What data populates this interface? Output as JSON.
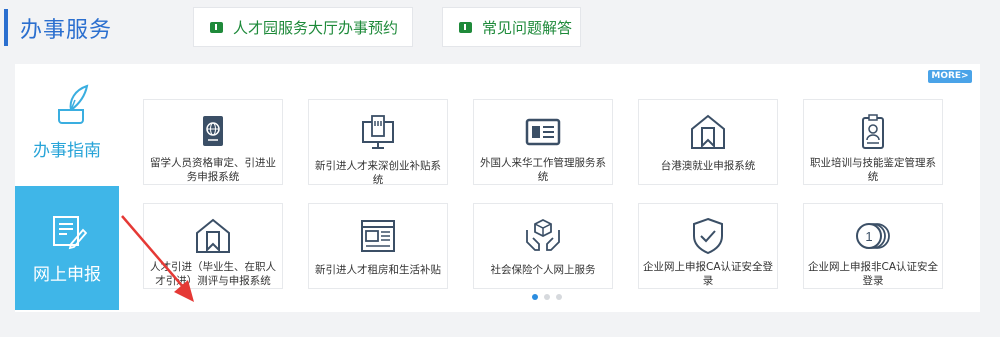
{
  "header": {
    "title": "办事服务",
    "links": [
      {
        "label": "人才园服务大厅办事预约",
        "icon": "flag-icon"
      },
      {
        "label": "常见问题解答",
        "icon": "flag-icon"
      }
    ]
  },
  "panel": {
    "more_label": "MORE>",
    "tabs": [
      {
        "label": "办事指南",
        "icon": "quill-pen-icon",
        "active": false
      },
      {
        "label": "网上申报",
        "icon": "document-edit-icon",
        "active": true
      }
    ],
    "row1": [
      {
        "label": "留学人员资格审定、引进业务申报系统",
        "icon": "passport-icon"
      },
      {
        "label": "新引进人才来深创业补贴系统",
        "icon": "monitor-building-icon"
      },
      {
        "label": "外国人来华工作管理服务系统",
        "icon": "id-card-icon"
      },
      {
        "label": "台港澳就业申报系统",
        "icon": "house-bookmark-icon"
      },
      {
        "label": "职业培训与技能鉴定管理系统",
        "icon": "badge-icon"
      }
    ],
    "row2": [
      {
        "label": "人才引进（毕业生、在职人才引进）测评与申报系统",
        "icon": "house-bookmark-icon"
      },
      {
        "label": "新引进人才租房和生活补贴",
        "icon": "window-layout-icon"
      },
      {
        "label": "社会保险个人网上服务",
        "icon": "hands-box-icon"
      },
      {
        "label": "企业网上申报CA认证安全登录",
        "icon": "shield-check-icon"
      },
      {
        "label": "企业网上申报非CA认证安全登录",
        "icon": "coins-icon"
      }
    ],
    "pagination": {
      "pages": 3,
      "current": 1
    }
  },
  "colors": {
    "accent": "#2b6fcf",
    "tab_active": "#3fb6e8",
    "link_green": "#1e8a3a",
    "icon_stroke": "#3b4f66",
    "arrow": "#e53935"
  }
}
